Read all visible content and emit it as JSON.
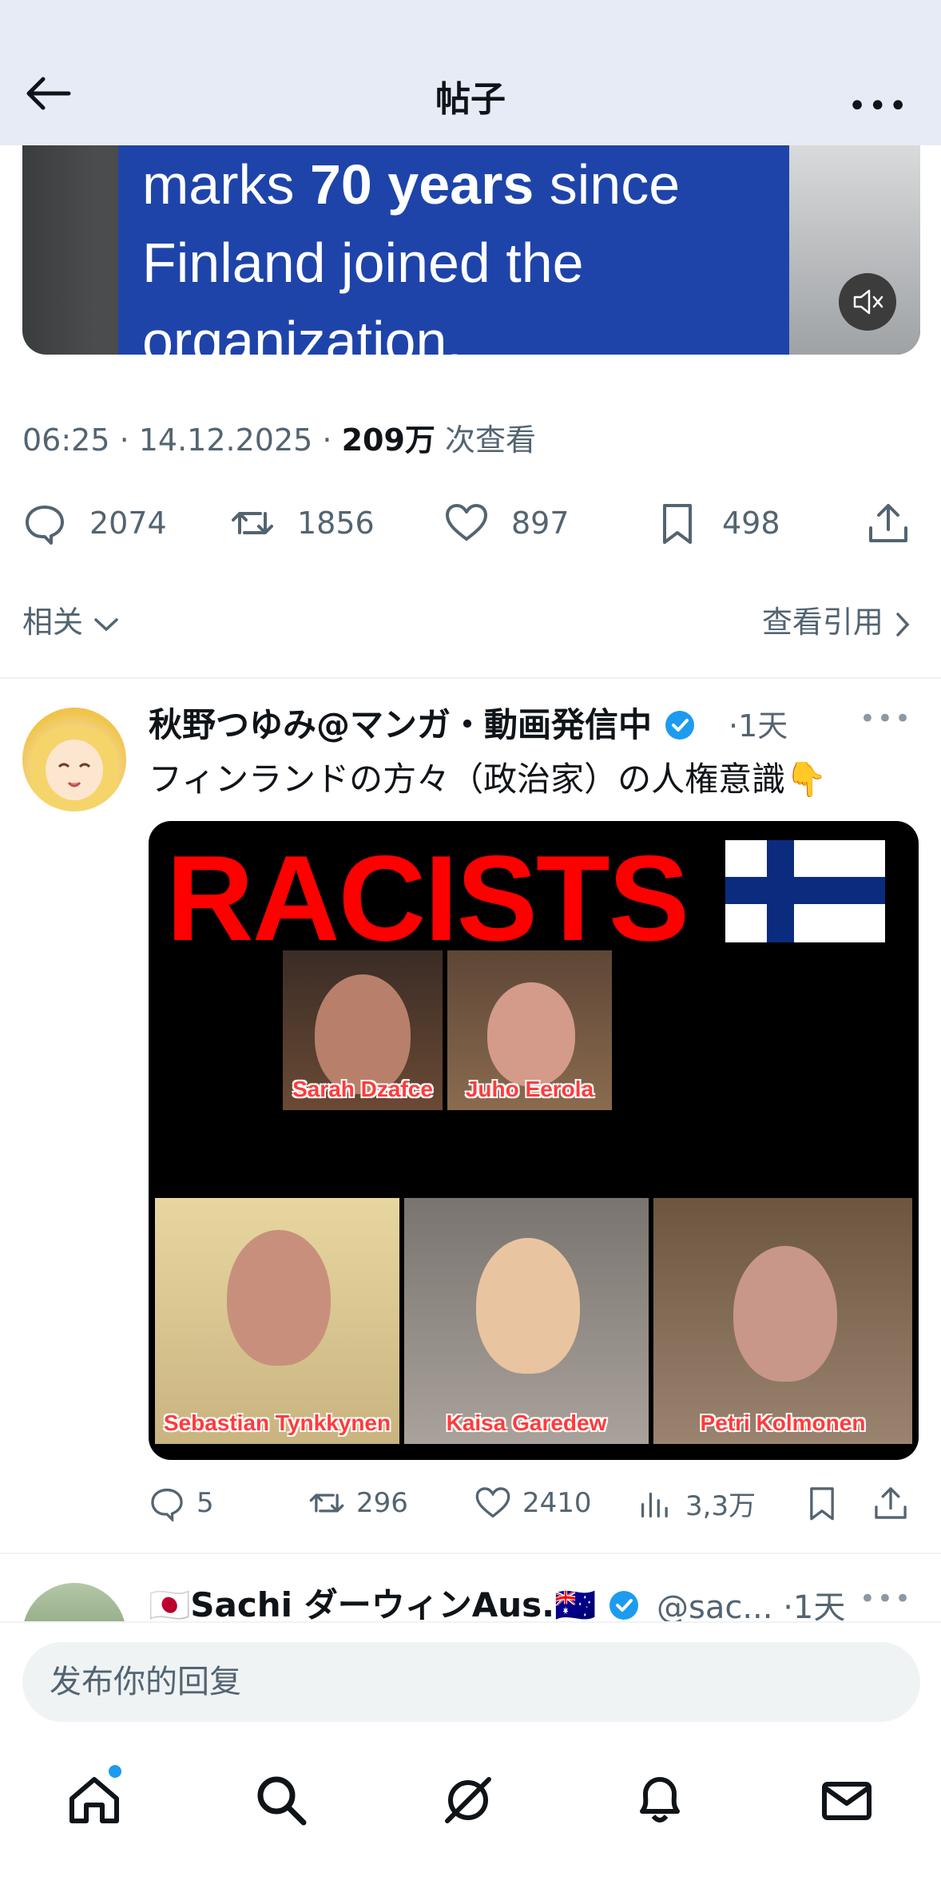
{
  "header": {
    "title": "帖子",
    "more": "•••"
  },
  "media": {
    "caption_line1_pre": "marks ",
    "caption_line1_bold": "70 years",
    "caption_line1_post": " since",
    "caption_line2": "Finland joined the",
    "caption_line3": "organization."
  },
  "meta": {
    "time": "06:25 · 14.12.2025 · ",
    "views": "209万",
    "views_suffix": " 次查看"
  },
  "stats": {
    "replies": "2074",
    "reposts": "1856",
    "likes": "897",
    "bookmarks": "498"
  },
  "related": {
    "label": "相关",
    "quotes_label": "查看引用"
  },
  "reply_tweet": {
    "name": "秋野つゆみ@マンガ・動画発信中",
    "time": "·1天",
    "text": "フィンランドの方々（政治家）の人権意識👇",
    "image_title": "RACISTS",
    "people": [
      "Sarah Dzafce",
      "Juho Eerola",
      "Sebastian Tynkkynen",
      "Kaisa Garedew",
      "Petri Kolmonen"
    ],
    "replies": "5",
    "reposts": "296",
    "likes": "2410",
    "views": "3,3万"
  },
  "next_tweet": {
    "name": "🇯🇵Sachi ダーウィンAus.🇦🇺",
    "handle": "@sac... ·1天"
  },
  "compose": {
    "placeholder": "发布你的回复"
  },
  "colors": {
    "accent": "#1d9bf0",
    "muted": "#536471",
    "text": "#0f1419",
    "racists_red": "#ff0000"
  }
}
